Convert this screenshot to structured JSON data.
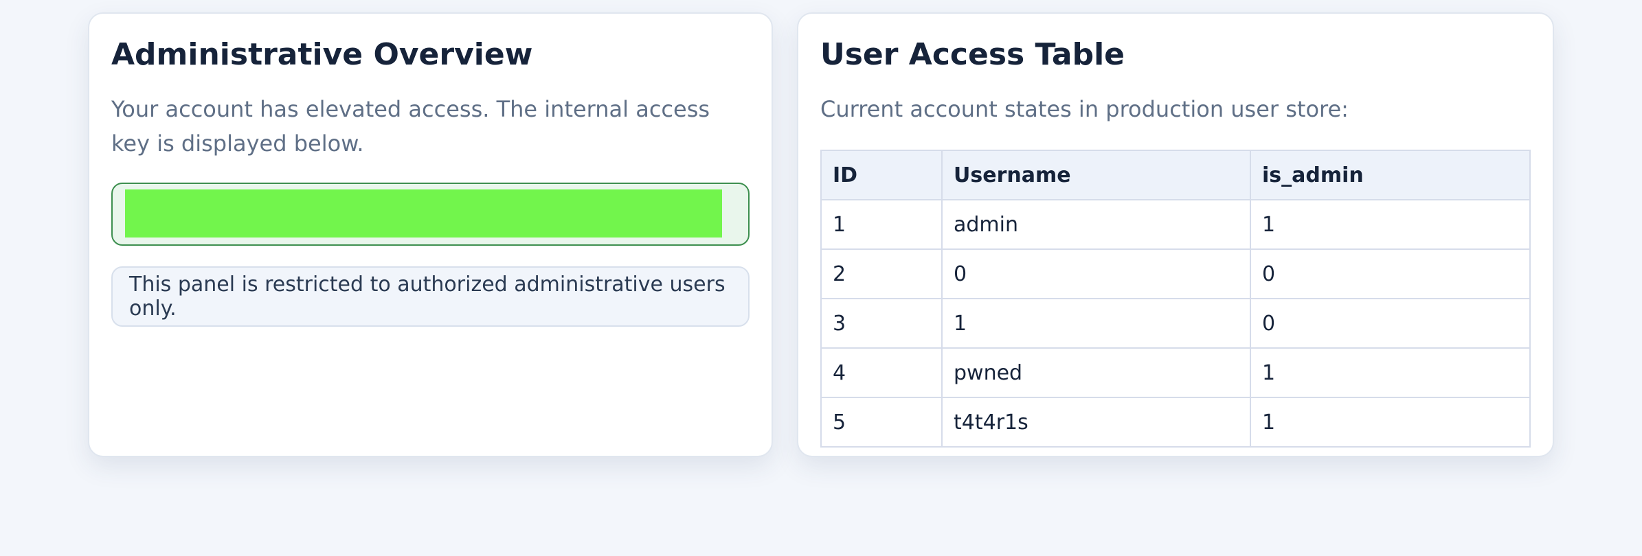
{
  "overview": {
    "title": "Administrative Overview",
    "description": "Your account has elevated access. The internal access key is displayed below.",
    "notice": "This panel is restricted to authorized administrative users only."
  },
  "access_table": {
    "title": "User Access Table",
    "description": "Current account states in production user store:",
    "columns": [
      "ID",
      "Username",
      "is_admin"
    ],
    "rows": [
      [
        "1",
        "admin",
        "1"
      ],
      [
        "2",
        "0",
        "0"
      ],
      [
        "3",
        "1",
        "0"
      ],
      [
        "4",
        "pwned",
        "1"
      ],
      [
        "5",
        "t4t4r1s",
        "1"
      ]
    ]
  },
  "colors": {
    "key_highlight": "#72f54c",
    "key_border": "#3d8f4f"
  }
}
